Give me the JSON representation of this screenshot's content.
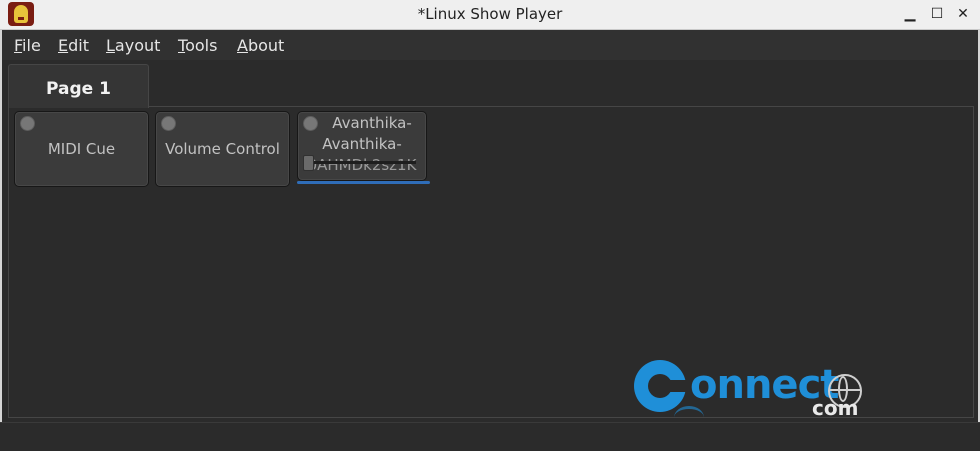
{
  "window": {
    "title": "*Linux Show Player",
    "controls": {
      "minimize": "▁",
      "maximize": "☐",
      "close": "✕"
    }
  },
  "menu": {
    "items": [
      {
        "first": "F",
        "rest": "ile"
      },
      {
        "first": "E",
        "rest": "dit"
      },
      {
        "first": "L",
        "rest": "ayout"
      },
      {
        "first": "T",
        "rest": "ools"
      },
      {
        "first": "A",
        "rest": "bout"
      }
    ]
  },
  "tabs": [
    {
      "label": "Page 1",
      "active": true
    }
  ],
  "cues": [
    {
      "label": "MIDI Cue"
    },
    {
      "label": "Volume Control"
    },
    {
      "label_line1": "Avanthika-",
      "label_line2": "Avanthika-",
      "label_line3": "0AHMDk2sz1K",
      "volume": 0.0,
      "progress": 1.0
    }
  ],
  "watermark": {
    "word": "onnect",
    "suffix": "com"
  },
  "colors": {
    "accent": "#2f6db8",
    "watermark_blue": "#1f8fd8"
  },
  "icons": {
    "app": "lightbulb-icon",
    "led": "status-led-icon",
    "globe": "globe-icon"
  }
}
